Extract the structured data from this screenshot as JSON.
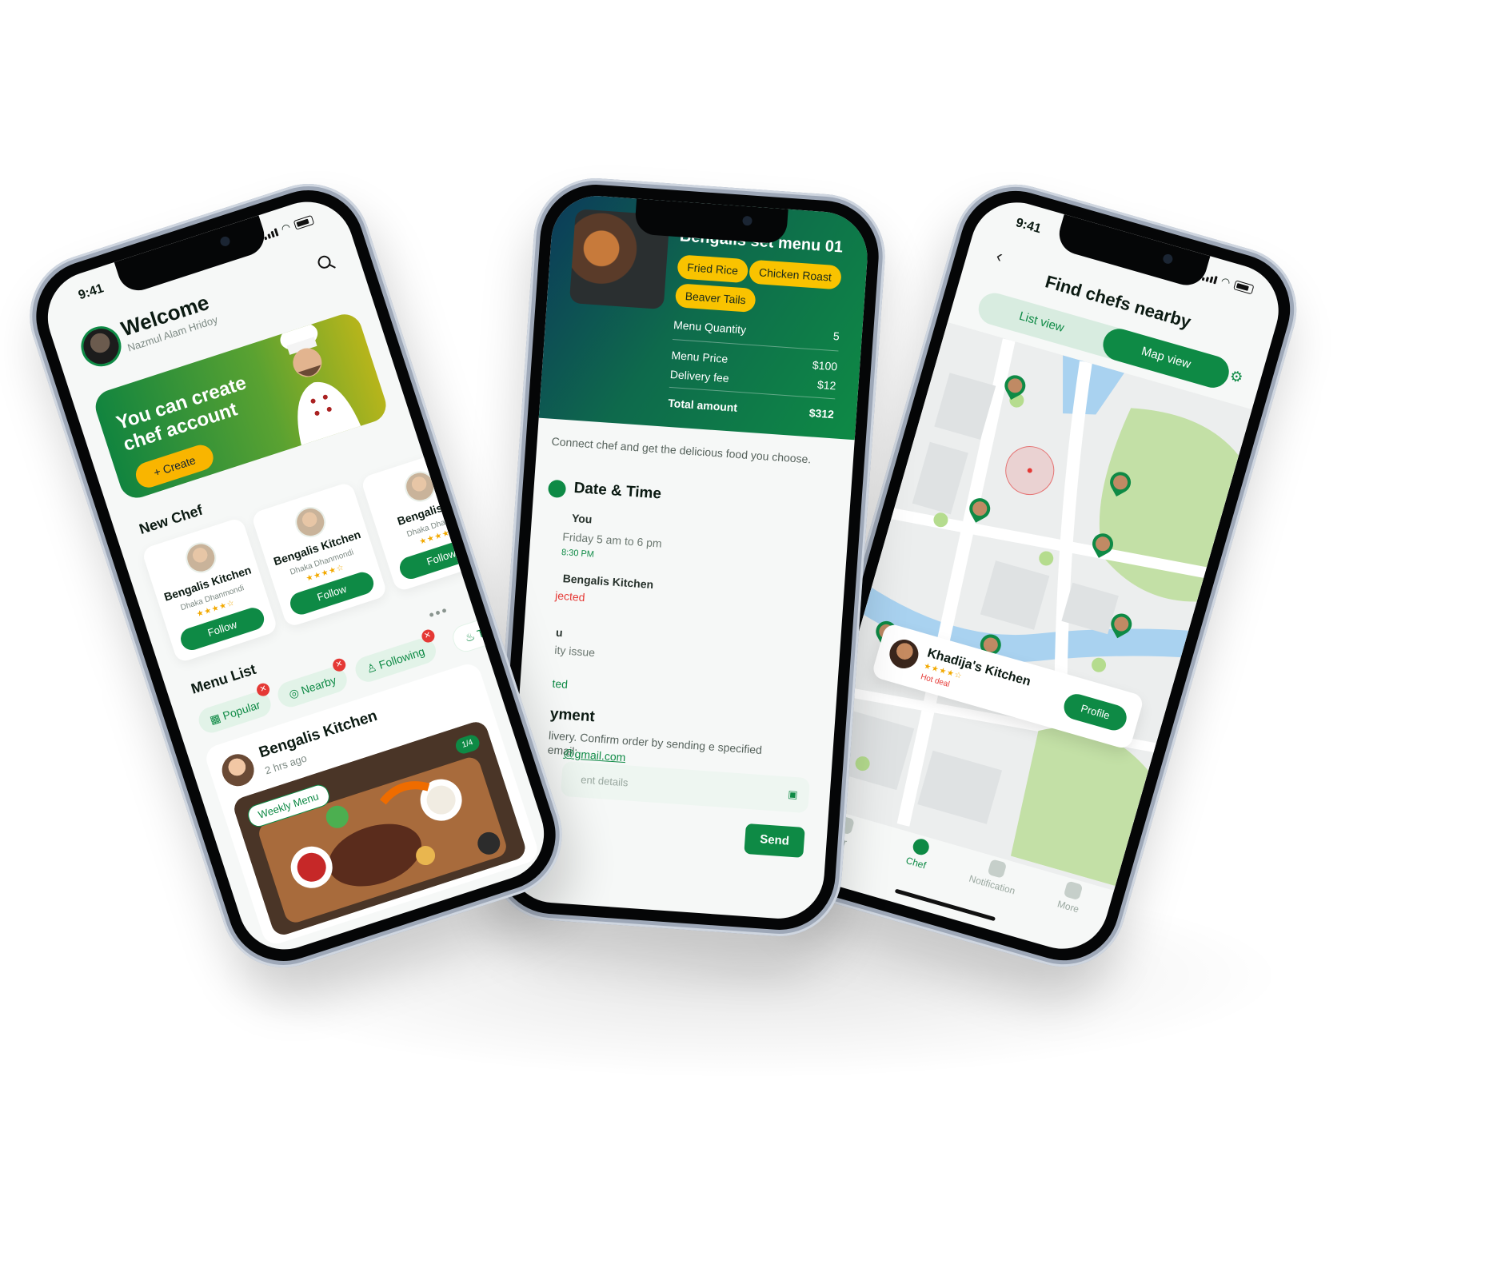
{
  "colors": {
    "brand_green": "#0e8a45",
    "accent_yellow": "#f9b500",
    "danger_red": "#e53935",
    "background": "#ffffff"
  },
  "phone1": {
    "status_time": "9:41",
    "welcome": "Welcome",
    "user_name": "Nazmul Alam Hridoy",
    "banner_text": "You can create chef account",
    "create_label": "Create",
    "new_chef_title": "New Chef",
    "chefs": [
      {
        "name": "Bengalis Kitchen",
        "location": "Dhaka Dhanmondi",
        "stars": "★★★★☆",
        "follow": "Follow"
      },
      {
        "name": "Bengalis Kitchen",
        "location": "Dhaka Dhanmondi",
        "stars": "★★★★☆",
        "follow": "Follow"
      },
      {
        "name": "Bengalis Ki",
        "location": "Dhaka Dhanm",
        "stars": "★★★★",
        "follow": "Follow"
      }
    ],
    "menu_list_title": "Menu List",
    "filters": [
      "Popular",
      "Nearby",
      "Following",
      "Tre"
    ],
    "post": {
      "title": "Bengalis Kitchen",
      "time": "2 hrs ago",
      "tag": "Weekly Menu",
      "counter": "1/4"
    }
  },
  "phone2": {
    "menu_title": "Bengalis set menu 01",
    "items": [
      "Fried Rice",
      "Chicken Roast",
      "Beaver Tails"
    ],
    "quantity_label": "Menu Quantity",
    "quantity_value": "5",
    "price_label": "Menu Price",
    "price_value": "$100",
    "delivery_label": "Delivery fee",
    "delivery_value": "$12",
    "total_label": "Total amount",
    "total_value": "$312",
    "intro": "Connect chef and get the delicious food you choose.",
    "date_time_title": "Date & Time",
    "you_label": "You",
    "time_range": "Friday 5 am to 6 pm",
    "time_stamp": "8:30 PM",
    "kitchen_label": "Bengalis Kitchen",
    "status_rejected": "jected",
    "reply_who": "u",
    "reply_reason": "ity issue",
    "accepted_partial": "ted",
    "payment_title": "yment",
    "payment_text": "livery. Confirm order by sending e specified email:",
    "email_partial": "@gmail.com",
    "input_placeholder": "ent details",
    "send_label": "Send"
  },
  "phone3": {
    "status_time": "9:41",
    "title": "Find chefs nearby",
    "list_view": "List view",
    "map_view": "Map view",
    "card": {
      "name": "Khadija's Kitchen",
      "stars": "★★★★☆",
      "hot": "Hot deal",
      "profile": "Profile"
    },
    "tabs": [
      "der",
      "Chef",
      "Notification",
      "More"
    ]
  }
}
